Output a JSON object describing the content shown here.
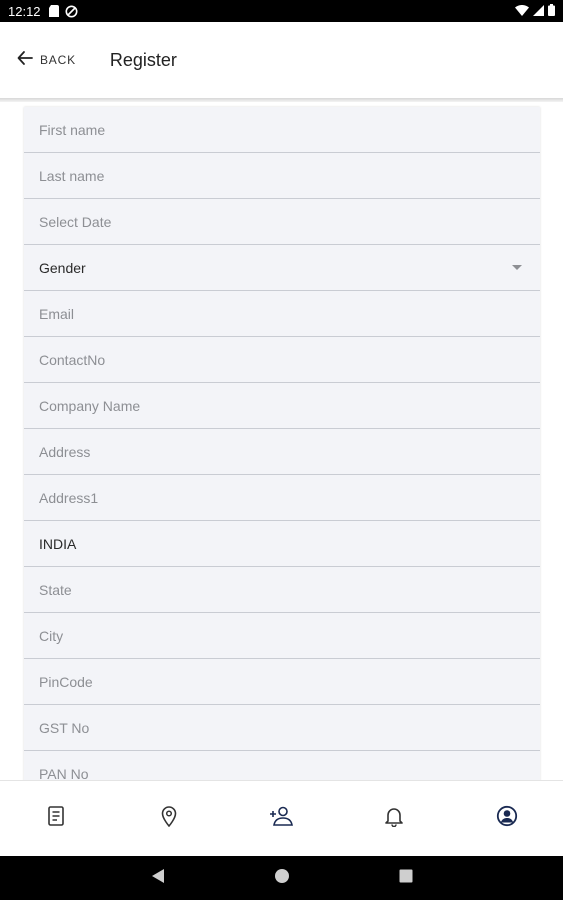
{
  "status_bar": {
    "time": "12:12",
    "icons": [
      "sd-card-icon",
      "data-saver-icon",
      "wifi-icon",
      "signal-icon",
      "battery-icon"
    ]
  },
  "app_bar": {
    "back_label": "BACK",
    "title": "Register"
  },
  "form": {
    "first_name": {
      "placeholder": "First name"
    },
    "last_name": {
      "placeholder": "Last name"
    },
    "dob": {
      "placeholder": "Select Date"
    },
    "gender": {
      "value": "Gender"
    },
    "email": {
      "placeholder": "Email"
    },
    "contact": {
      "placeholder": "ContactNo"
    },
    "company": {
      "placeholder": "Company Name"
    },
    "address": {
      "placeholder": "Address"
    },
    "address1": {
      "placeholder": "Address1"
    },
    "country": {
      "value": "INDIA"
    },
    "state": {
      "placeholder": "State"
    },
    "city": {
      "placeholder": "City"
    },
    "pincode": {
      "placeholder": "PinCode"
    },
    "gst": {
      "placeholder": "GST No"
    },
    "pan": {
      "placeholder": "PAN No"
    }
  },
  "bottom_nav": {
    "items": [
      "document-icon",
      "location-pin-icon",
      "add-user-icon",
      "bell-icon",
      "profile-icon"
    ]
  },
  "system_nav": {
    "items": [
      "back-triangle-icon",
      "home-circle-icon",
      "recents-square-icon"
    ]
  },
  "colors": {
    "field_background": "#f3f4f8",
    "placeholder_text": "#8d8f94",
    "active_nav": "#1a2a52"
  }
}
